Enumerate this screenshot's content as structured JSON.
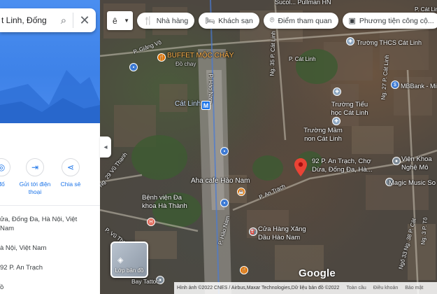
{
  "search": {
    "value": "t Linh, Đống"
  },
  "chips": {
    "layer_select": "ê",
    "items": [
      {
        "label": "Nhà hàng",
        "icon": "restaurant-icon"
      },
      {
        "label": "Khách sạn",
        "icon": "hotel-icon"
      },
      {
        "label": "Điểm tham quan",
        "icon": "camera-icon"
      },
      {
        "label": "Phương tiện công cộ...",
        "icon": "bus-icon"
      }
    ]
  },
  "actions": [
    {
      "label": "đố",
      "icon": "nearby-icon"
    },
    {
      "label": "Gửi tới điện thoại",
      "icon": "send-to-phone-icon"
    },
    {
      "label": "Chia sẻ",
      "icon": "share-icon"
    }
  ],
  "info": {
    "address_line1": "ửa, Đống Đa, Hà Nội, Việt",
    "address_line2": "Nam",
    "city_line": "à Nội, Việt Nam",
    "plus_line": "92 P. An Trạch",
    "bottom_line": "ồ"
  },
  "map": {
    "pois": {
      "top_street": "Sucol...  Pullman HN",
      "top_right": "P. Cát Linh",
      "giang_vo": "P. Giảng Võ",
      "buffet": "BUFFET MỘC CHÂY",
      "buffet_sub": "Đồ chay",
      "cat_linh_top": "P. Cát Linh",
      "thcs": "Trường THCS Cát Linh",
      "mbbank": "MBBank - Mi",
      "cat_linh_station": "Cát Linh",
      "tieu_hoc": "Trường Tiểu học Cát Linh",
      "mam_non": "Trường Mầm non Cát Linh",
      "main_place": "92 P. An Trạch, Chợ Dừa, Đống Đa, Hà...",
      "vien_khoa": "Viện Khoa Nghệ Mô",
      "aha": "Aha cafe Hào Nam",
      "magic": "Magic Music So",
      "benh_vien": "Bệnh viện Đa khoa Hà Thành",
      "cua_hang": "Cửa Hàng Xăng Dầu Hào Nam",
      "bay_tattoo": "Bay Tattoo"
    },
    "streets": {
      "hao_nam_1": "P. Hào Nam",
      "ng_35": "Ng. 35 P. Cát Linh",
      "ng_27": "Ng. 27 P. Cát Linh",
      "an_trach": "P. An Trạch",
      "vu_thanh_1": "Ng. 29 Vũ Thạnh",
      "vu_thanh_2": "P. Vũ Thạnh",
      "hao_nam_2": "P. Hào Nam",
      "ng_33": "Ngõ 33 Ng. 38 P. Cát",
      "right_vertical": "Ng. 3 P. Tô"
    },
    "metro_icon": "M",
    "google": "Google",
    "layers_label": "Lớp bản đồ"
  },
  "footer": {
    "attribution": "Hình ảnh ©2022 CNES / Airbus,Maxar Technologies,Dữ liệu bản đồ ©2022",
    "links": [
      "Toàn cầu",
      "Điều khoản",
      "Bảo mật"
    ]
  }
}
